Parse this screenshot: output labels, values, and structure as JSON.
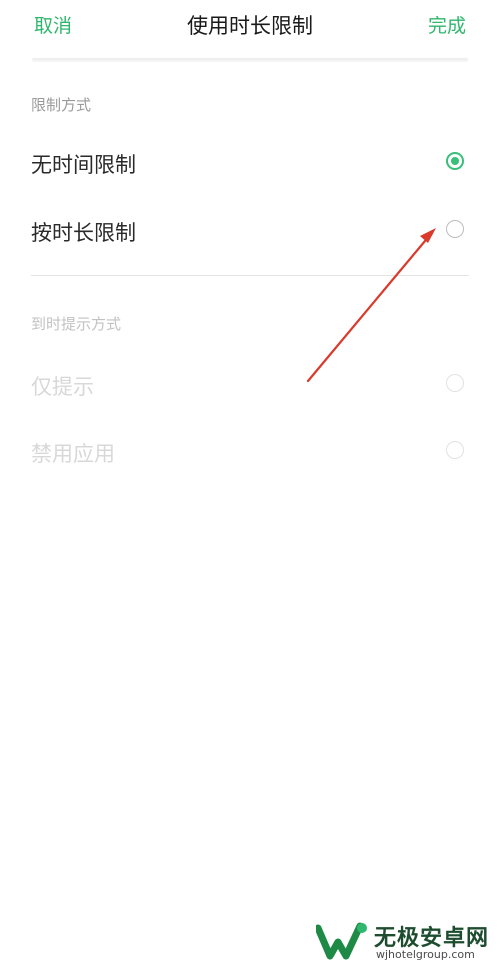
{
  "header": {
    "cancel_label": "取消",
    "title": "使用时长限制",
    "done_label": "完成"
  },
  "limit_mode": {
    "header": "限制方式",
    "options": [
      {
        "label": "无时间限制",
        "selected": true
      },
      {
        "label": "按时长限制",
        "selected": false
      }
    ]
  },
  "reminder_mode": {
    "header": "到时提示方式",
    "options": [
      {
        "label": "仅提示",
        "selected": false,
        "enabled": false
      },
      {
        "label": "禁用应用",
        "selected": false,
        "enabled": false
      }
    ]
  },
  "watermark": {
    "name": "无极安卓网",
    "url": "wjhotelgroup.com"
  },
  "colors": {
    "accent": "#2fb76d",
    "annotation": "#d93a2b"
  }
}
